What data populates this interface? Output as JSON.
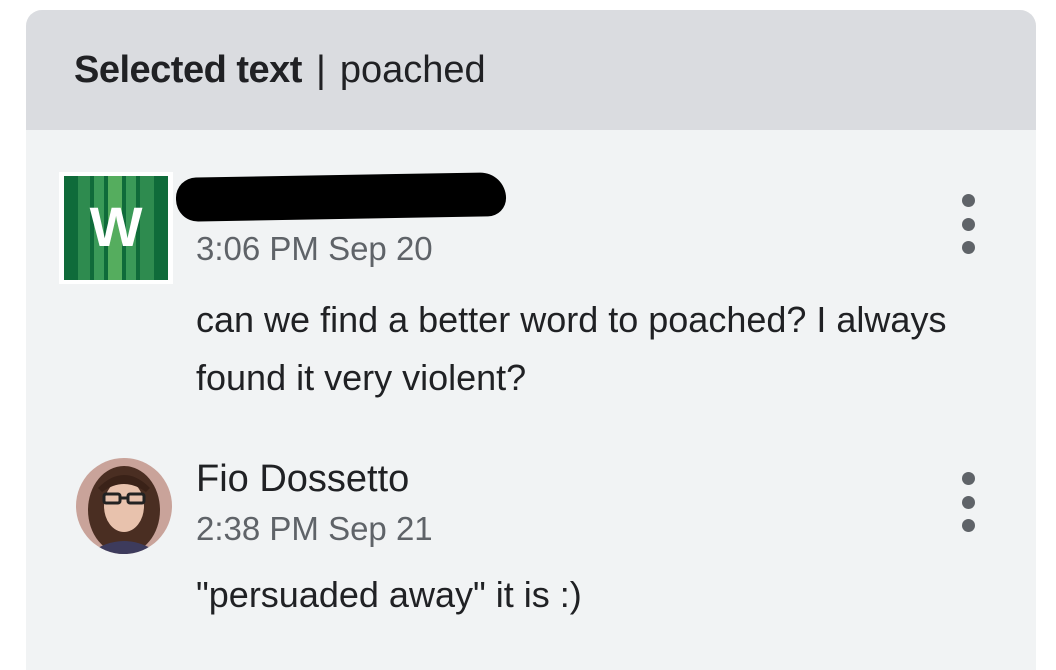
{
  "header": {
    "label": "Selected text",
    "separator": "|",
    "value": "poached"
  },
  "comments": [
    {
      "avatar_icon": "w-logo-icon",
      "avatar_letter": "W",
      "author": "",
      "author_redacted": true,
      "time": "3:06 PM Sep 20",
      "text": "can we find a better word to poached? I always found it very violent?"
    },
    {
      "avatar_icon": "user-photo-avatar",
      "author": "Fio Dossetto",
      "time": "2:38 PM Sep 21",
      "text": "\"persuaded away\" it is :)"
    }
  ],
  "colors": {
    "header_bg": "#dadce0",
    "card_bg": "#f1f3f4",
    "logo_green": "#1e7b46",
    "text": "#202124",
    "secondary": "#5f6368"
  }
}
